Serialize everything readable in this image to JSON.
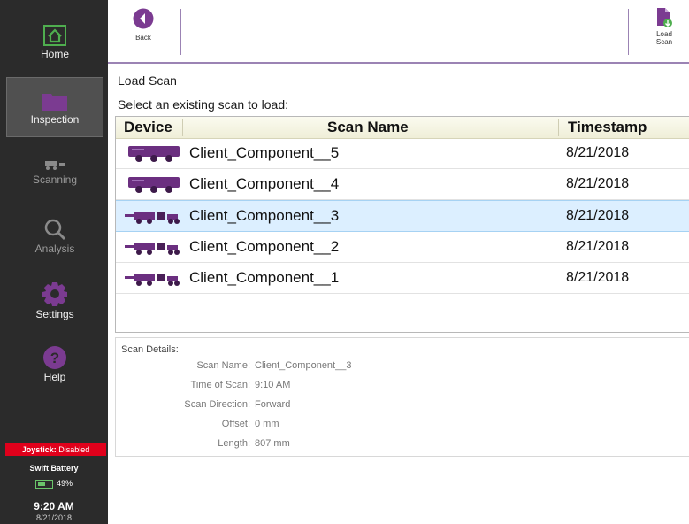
{
  "sidebar": {
    "items": [
      {
        "label": "Home",
        "icon": "home-icon"
      },
      {
        "label": "Inspection",
        "icon": "folder-icon"
      },
      {
        "label": "Scanning",
        "icon": "scanner-icon"
      },
      {
        "label": "Analysis",
        "icon": "magnifier-icon"
      },
      {
        "label": "Settings",
        "icon": "gear-icon"
      },
      {
        "label": "Help",
        "icon": "help-icon"
      }
    ],
    "joystick_label": "Joystick:",
    "joystick_status": "Disabled",
    "battery_title": "Swift Battery",
    "battery_percent": "49%",
    "clock_time": "9:20 AM",
    "clock_date": "8/21/2018"
  },
  "toolbar": {
    "back_label": "Back",
    "load_label_1": "Load",
    "load_label_2": "Scan"
  },
  "content": {
    "title": "Load Scan",
    "subtitle": "Select an existing scan to load:"
  },
  "table": {
    "headers": {
      "device": "Device",
      "scan_name": "Scan Name",
      "timestamp": "Timestamp"
    },
    "rows": [
      {
        "device_type": "crawler-large",
        "scan_name": "Client_Component__5",
        "timestamp": "8/21/2018",
        "selected": false
      },
      {
        "device_type": "crawler-large",
        "scan_name": "Client_Component__4",
        "timestamp": "8/21/2018",
        "selected": false
      },
      {
        "device_type": "crawler-small",
        "scan_name": "Client_Component__3",
        "timestamp": "8/21/2018",
        "selected": true
      },
      {
        "device_type": "crawler-small",
        "scan_name": "Client_Component__2",
        "timestamp": "8/21/2018",
        "selected": false
      },
      {
        "device_type": "crawler-small",
        "scan_name": "Client_Component__1",
        "timestamp": "8/21/2018",
        "selected": false
      }
    ]
  },
  "details": {
    "title": "Scan Details:",
    "fields": [
      {
        "key": "Scan Name:",
        "value": "Client_Component__3"
      },
      {
        "key": "Time of Scan:",
        "value": "9:10 AM"
      },
      {
        "key": "Scan Direction:",
        "value": "Forward"
      },
      {
        "key": "Offset:",
        "value": "0 mm"
      },
      {
        "key": "Length:",
        "value": "807 mm"
      }
    ]
  },
  "colors": {
    "sidebar_bg": "#2b2b2b",
    "accent_purple": "#7b3b91",
    "toolbar_rule": "#9b83b4",
    "selected_row": "#dcefff",
    "joystick_red": "#e0001b",
    "home_green": "#4fae4f"
  }
}
